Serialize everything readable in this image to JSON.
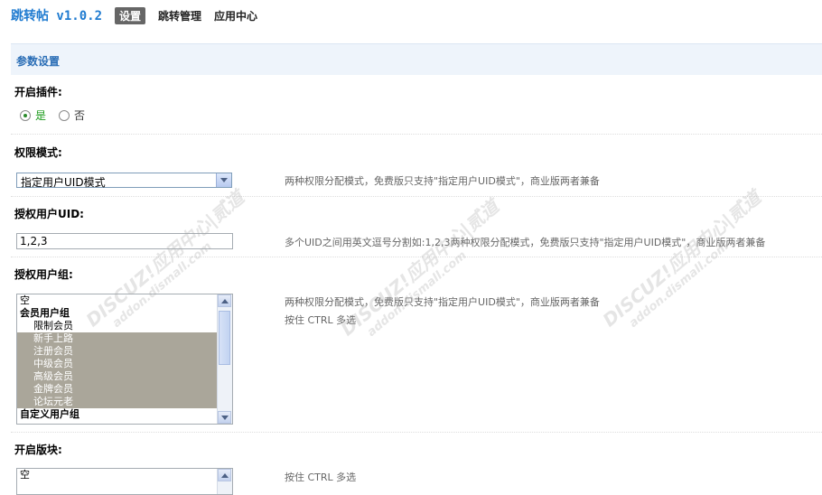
{
  "header": {
    "app_title": "跳转帖 v1.0.2",
    "tabs": [
      {
        "label": "设置"
      },
      {
        "label": "跳转管理"
      },
      {
        "label": "应用中心"
      }
    ]
  },
  "section_title": "参数设置",
  "plugin_enable": {
    "label": "开启插件:",
    "options": [
      {
        "label": "是"
      },
      {
        "label": "否"
      }
    ],
    "selected": "是"
  },
  "permission_mode": {
    "label": "权限模式:",
    "value": "指定用户UID模式",
    "hint": "两种权限分配模式，免费版只支持\"指定用户UID模式\"，商业版两者兼备"
  },
  "auth_uid": {
    "label": "授权用户UID:",
    "value": "1,2,3",
    "hint": "多个UID之间用英文逗号分割如:1,2,3两种权限分配模式，免费版只支持\"指定用户UID模式\"，商业版两者兼备"
  },
  "auth_groups": {
    "label": "授权用户组:",
    "hint1": "两种权限分配模式，免费版只支持\"指定用户UID模式\"，商业版两者兼备",
    "hint2": "按住 CTRL 多选",
    "items": [
      {
        "label": "空"
      },
      {
        "label": "会员用户组"
      },
      {
        "label": "限制会员"
      },
      {
        "label": "新手上路"
      },
      {
        "label": "注册会员"
      },
      {
        "label": "中级会员"
      },
      {
        "label": "高级会员"
      },
      {
        "label": "金牌会员"
      },
      {
        "label": "论坛元老"
      },
      {
        "label": "自定义用户组"
      }
    ]
  },
  "enable_forums": {
    "label": "开启版块:",
    "hint": "按住 CTRL 多选",
    "items": [
      {
        "label": "空"
      }
    ]
  },
  "watermark": {
    "line1": "DISCUZ!应用中心|贰道",
    "line2": "addon.dismall.com"
  }
}
